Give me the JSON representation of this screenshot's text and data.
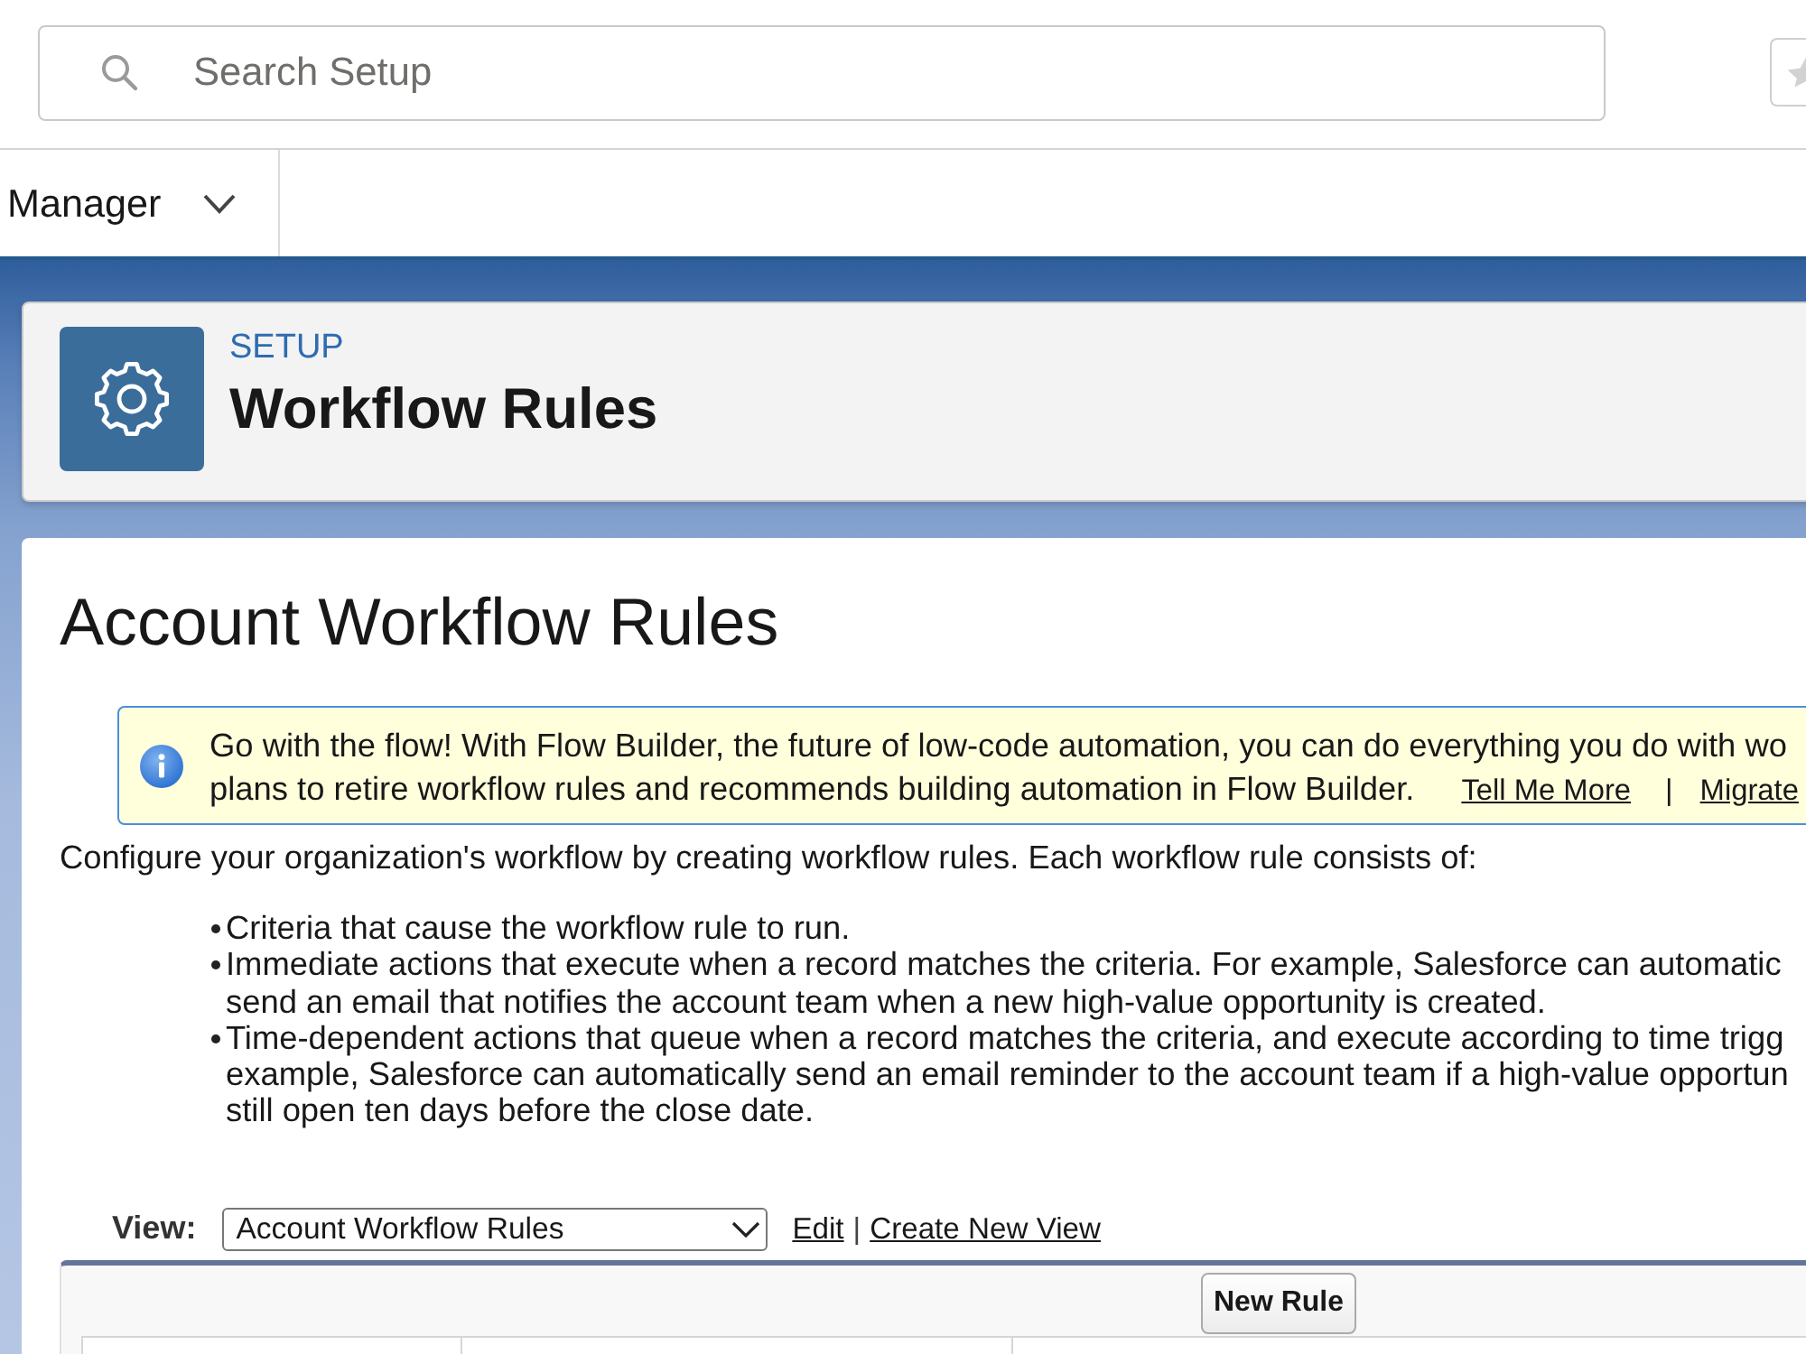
{
  "search": {
    "placeholder": "Search Setup"
  },
  "nav_tab": {
    "label": "Manager"
  },
  "header": {
    "eyebrow": "SETUP",
    "title": "Workflow Rules"
  },
  "page_title": "Account Workflow Rules",
  "info_banner": {
    "lines": [
      "Go with the flow! With Flow Builder, the future of low-code automation, you can do everything you do with wo",
      "plans to retire workflow rules and recommends building automation in Flow Builder."
    ],
    "links": [
      "Tell Me More",
      "Migrate"
    ],
    "separator": "|"
  },
  "intro": "Configure your organization's workflow by creating workflow rules. Each workflow rule consists of:",
  "bullets": [
    {
      "lines": [
        "Criteria that cause the workflow rule to run."
      ]
    },
    {
      "lines": [
        "Immediate actions that execute when a record matches the criteria. For example, Salesforce can automatic",
        "send an email that notifies the account team when a new high-value opportunity is created."
      ]
    },
    {
      "lines": [
        "Time-dependent actions that queue when a record matches the criteria, and execute according to time trigg",
        "example, Salesforce can automatically send an email reminder to the account team if a high-value opportun",
        "still open ten days before the close date."
      ]
    }
  ],
  "view": {
    "label": "View:",
    "value": "Account Workflow Rules",
    "links": [
      "Edit",
      "Create New View"
    ],
    "separator": "|"
  },
  "table": {
    "button": "New Rule"
  }
}
